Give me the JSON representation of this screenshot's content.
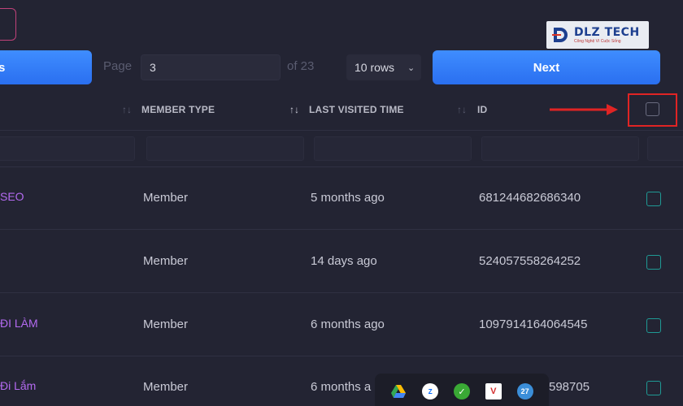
{
  "pagination": {
    "prev_label": "s",
    "page_label": "Page",
    "page_value": "3",
    "of_label": "of 23",
    "rows_value": "10 rows",
    "next_label": "Next"
  },
  "logo": {
    "text": "DLZ TECH",
    "subtext": "Công Nghệ Vì Cuộc Sống"
  },
  "columns": {
    "member_type": "MEMBER TYPE",
    "last_visited": "LAST VISITED TIME",
    "id": "ID"
  },
  "rows": [
    {
      "name": "SEO",
      "member_type": "Member",
      "last_visited": "5 months ago",
      "id": "681244682686340"
    },
    {
      "name": "",
      "member_type": "Member",
      "last_visited": "14 days ago",
      "id": "524057558264252"
    },
    {
      "name": "ĐI LÀM",
      "member_type": "Member",
      "last_visited": "6 months ago",
      "id": "1097914164064545"
    },
    {
      "name": "Đi Lắm",
      "member_type": "Member",
      "last_visited": "6 months a",
      "id": "598705"
    }
  ],
  "taskbar": {
    "icons": [
      "google-drive-icon",
      "zalo-icon",
      "shield-check-icon",
      "pdf-viewer-icon",
      "weather-icon"
    ],
    "weather_text": "27"
  },
  "colors": {
    "background": "#232433",
    "accent_blue": "#3a86ff",
    "name_purple": "#b36af0",
    "checkbox_teal": "#1f9a95",
    "highlight_red": "#e02424"
  }
}
